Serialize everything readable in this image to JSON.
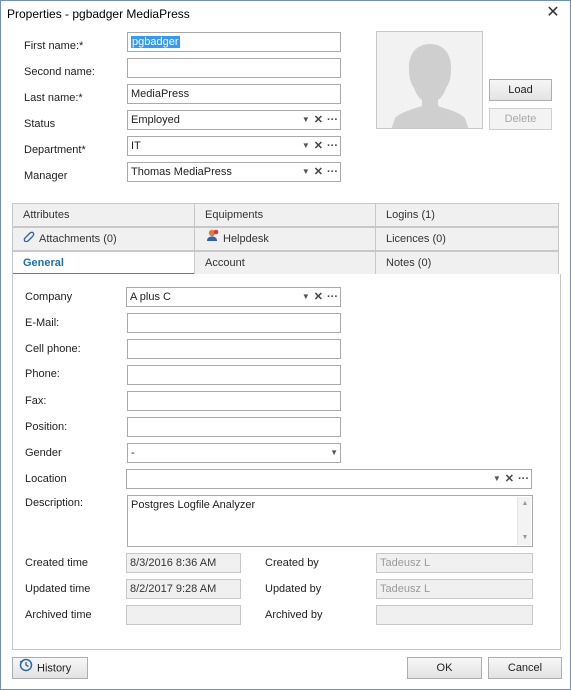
{
  "window": {
    "title": "Properties - pgbadger MediaPress"
  },
  "header": {
    "first_name": {
      "label": "First name:*",
      "value": "pgbadger"
    },
    "second_name": {
      "label": "Second name:",
      "value": ""
    },
    "last_name": {
      "label": "Last name:*",
      "value": "MediaPress"
    },
    "status": {
      "label": "Status",
      "value": "Employed"
    },
    "department": {
      "label": "Department*",
      "value": "IT"
    },
    "manager": {
      "label": "Manager",
      "value": "Thomas MediaPress"
    }
  },
  "photo": {
    "load_label": "Load",
    "delete_label": "Delete"
  },
  "tabs": [
    {
      "label": "Attributes"
    },
    {
      "label": "Equipments"
    },
    {
      "label": "Logins (1)"
    },
    {
      "label": "Attachments (0)"
    },
    {
      "label": "Helpdesk"
    },
    {
      "label": "Licences (0)"
    },
    {
      "label": "General"
    },
    {
      "label": "Account"
    },
    {
      "label": "Notes (0)"
    }
  ],
  "general": {
    "company": {
      "label": "Company",
      "value": "A plus C"
    },
    "email": {
      "label": "E-Mail:",
      "value": ""
    },
    "cell_phone": {
      "label": "Cell phone:",
      "value": ""
    },
    "phone": {
      "label": "Phone:",
      "value": ""
    },
    "fax": {
      "label": "Fax:",
      "value": ""
    },
    "position": {
      "label": "Position:",
      "value": ""
    },
    "gender": {
      "label": "Gender",
      "value": "-"
    },
    "location": {
      "label": "Location",
      "value": ""
    },
    "description": {
      "label": "Description:",
      "value": "Postgres Logfile Analyzer"
    },
    "created_time": {
      "label": "Created time",
      "value": "8/3/2016 8:36 AM"
    },
    "updated_time": {
      "label": "Updated time",
      "value": "8/2/2017 9:28 AM"
    },
    "archived_time": {
      "label": "Archived time",
      "value": ""
    },
    "created_by": {
      "label": "Created by",
      "value": "Tadeusz L"
    },
    "updated_by": {
      "label": "Updated by",
      "value": "Tadeusz L"
    },
    "archived_by": {
      "label": "Archived by",
      "value": ""
    }
  },
  "footer": {
    "history_label": "History",
    "ok_label": "OK",
    "cancel_label": "Cancel"
  },
  "colors": {
    "accent": "#2b88d8",
    "window_border": "#6e8fb8"
  }
}
